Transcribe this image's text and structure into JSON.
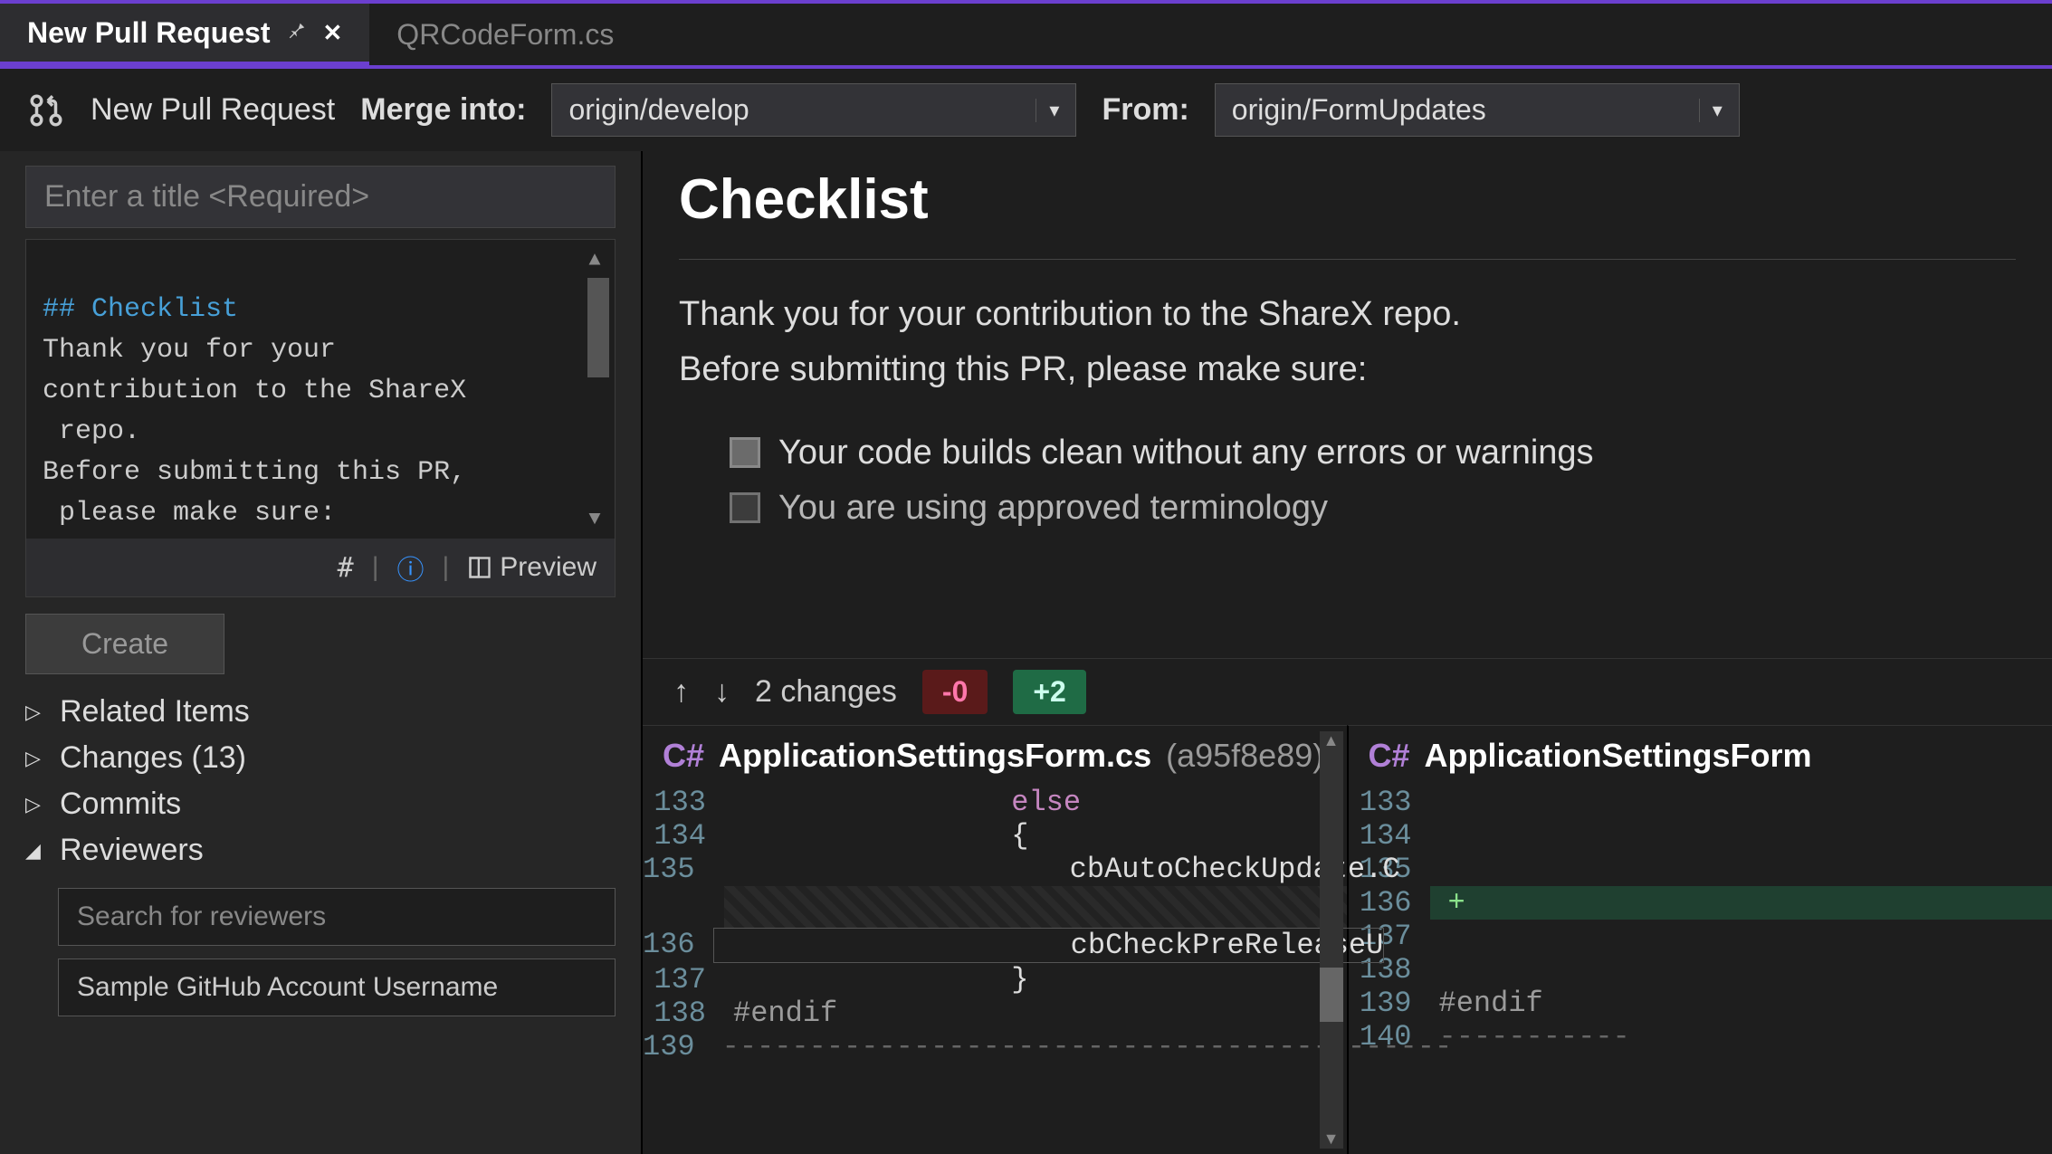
{
  "tabs": {
    "active": "New Pull Request",
    "inactive": "QRCodeForm.cs"
  },
  "toolbar": {
    "title": "New Pull Request",
    "merge_into_label": "Merge into:",
    "merge_into_value": "origin/develop",
    "from_label": "From:",
    "from_value": "origin/FormUpdates"
  },
  "left": {
    "title_placeholder": "Enter a title <Required>",
    "description_header": "## Checklist",
    "description_body": "Thank you for your\ncontribution to the ShareX\n repo.\nBefore submitting this PR,\n please make sure:\n\n- [x] Your code builds",
    "preview_label": "Preview",
    "create_label": "Create",
    "tree": {
      "related": "Related Items",
      "changes": "Changes (13)",
      "commits": "Commits",
      "reviewers": "Reviewers"
    },
    "reviewers_search_placeholder": "Search for reviewers",
    "reviewer_chip": "Sample GitHub Account Username"
  },
  "preview": {
    "heading": "Checklist",
    "para1": "Thank you for your contribution to the ShareX repo.",
    "para2": "Before submitting this PR, please make sure:",
    "item1": "Your code builds clean without any errors or warnings",
    "item2": "You are using approved terminology"
  },
  "diff": {
    "changes_label": "2 changes",
    "deletions": "-0",
    "additions": "+2",
    "file_lang": "C#",
    "file_name": "ApplicationSettingsForm.cs",
    "file_hash": "(a95f8e89)",
    "file_name_right": "ApplicationSettingsForm",
    "left_lines": [
      {
        "n": "133",
        "indent": "                ",
        "t": "else",
        "cls": "kw"
      },
      {
        "n": "134",
        "indent": "                ",
        "t": "{",
        "cls": ""
      },
      {
        "n": "135",
        "indent": "                    ",
        "t": "cbAutoCheckUpdate.C",
        "cls": ""
      },
      {
        "n": "",
        "indent": "",
        "t": "",
        "cls": "hatch"
      },
      {
        "n": "136",
        "indent": "                    ",
        "t": "cbCheckPreReleaseU",
        "cls": "sel"
      },
      {
        "n": "137",
        "indent": "                ",
        "t": "}",
        "cls": ""
      },
      {
        "n": "138",
        "indent": "",
        "t": "#endif",
        "cls": "pp"
      },
      {
        "n": "139",
        "indent": "",
        "t": "------------------------------------------",
        "cls": "dash"
      }
    ],
    "right_lines": [
      {
        "n": "133",
        "t": ""
      },
      {
        "n": "134",
        "t": ""
      },
      {
        "n": "135",
        "t": ""
      },
      {
        "n": "136",
        "t": "+",
        "cls": "add"
      },
      {
        "n": "137",
        "t": ""
      },
      {
        "n": "138",
        "t": ""
      },
      {
        "n": "139",
        "t": "#endif",
        "cls": "pp"
      },
      {
        "n": "140",
        "t": "-----------",
        "cls": "dash"
      }
    ]
  }
}
